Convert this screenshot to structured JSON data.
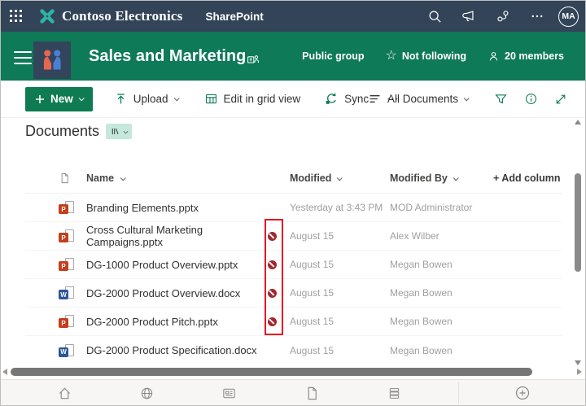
{
  "topbar": {
    "brand": "Contoso Electronics",
    "product": "SharePoint",
    "avatar_initials": "MA"
  },
  "site": {
    "title": "Sales and Marketing",
    "privacy": "Public group",
    "following": "Not following",
    "members": "20 members"
  },
  "toolbar": {
    "new_label": "New",
    "upload_label": "Upload",
    "edit_grid_label": "Edit in grid view",
    "sync_label": "Sync",
    "view_label": "All Documents"
  },
  "library": {
    "title": "Documents",
    "columns": {
      "name": "Name",
      "modified": "Modified",
      "modified_by": "Modified By",
      "add_column": "+ Add column"
    },
    "rows": [
      {
        "name": "Branding Elements.pptx",
        "type": "pptx",
        "blocked": false,
        "modified": "Yesterday at 3:43 PM",
        "modified_by": "MOD Administrator"
      },
      {
        "name": "Cross Cultural Marketing Campaigns.pptx",
        "type": "pptx",
        "blocked": true,
        "modified": "August 15",
        "modified_by": "Alex Wilber"
      },
      {
        "name": "DG-1000 Product Overview.pptx",
        "type": "pptx",
        "blocked": true,
        "modified": "August 15",
        "modified_by": "Megan Bowen"
      },
      {
        "name": "DG-2000 Product Overview.docx",
        "type": "docx",
        "blocked": true,
        "modified": "August 15",
        "modified_by": "Megan Bowen"
      },
      {
        "name": "DG-2000 Product Pitch.pptx",
        "type": "pptx",
        "blocked": true,
        "modified": "August 15",
        "modified_by": "Megan Bowen"
      },
      {
        "name": "DG-2000 Product Specification.docx",
        "type": "docx",
        "blocked": false,
        "modified": "August 15",
        "modified_by": "Megan Bowen"
      }
    ]
  },
  "file_letters": {
    "pptx": "P",
    "docx": "W"
  },
  "icons": {
    "topbar": [
      "app-launcher-waffle",
      "contoso-logo",
      "search",
      "megaphone",
      "share",
      "more-ellipsis",
      "avatar"
    ],
    "site_header": [
      "hamburger-menu",
      "site-logo-people",
      "teams",
      "star-outline",
      "person"
    ],
    "toolbar": [
      "plus",
      "upload-arrow",
      "grid-table",
      "sync-arrows",
      "more-ellipsis",
      "list-lines",
      "filter-funnel",
      "info-circle",
      "expand-diagonal"
    ],
    "row": [
      "powerpoint-file",
      "word-file",
      "blocked-slash-circle"
    ],
    "footer": [
      "home",
      "globe",
      "news",
      "page",
      "library-stack",
      "plus-circle"
    ]
  },
  "colors": {
    "topbar_bg": "#334458",
    "header_bg": "#0e7a57",
    "accent": "#0f7b53",
    "mint_badge": "#c5e8dc",
    "powerpoint": "#c43e1c",
    "word": "#2b579a",
    "blocked_badge": "#a4262c",
    "annotation_box": "#e81123",
    "logo_teal": "#2cb5a5"
  }
}
